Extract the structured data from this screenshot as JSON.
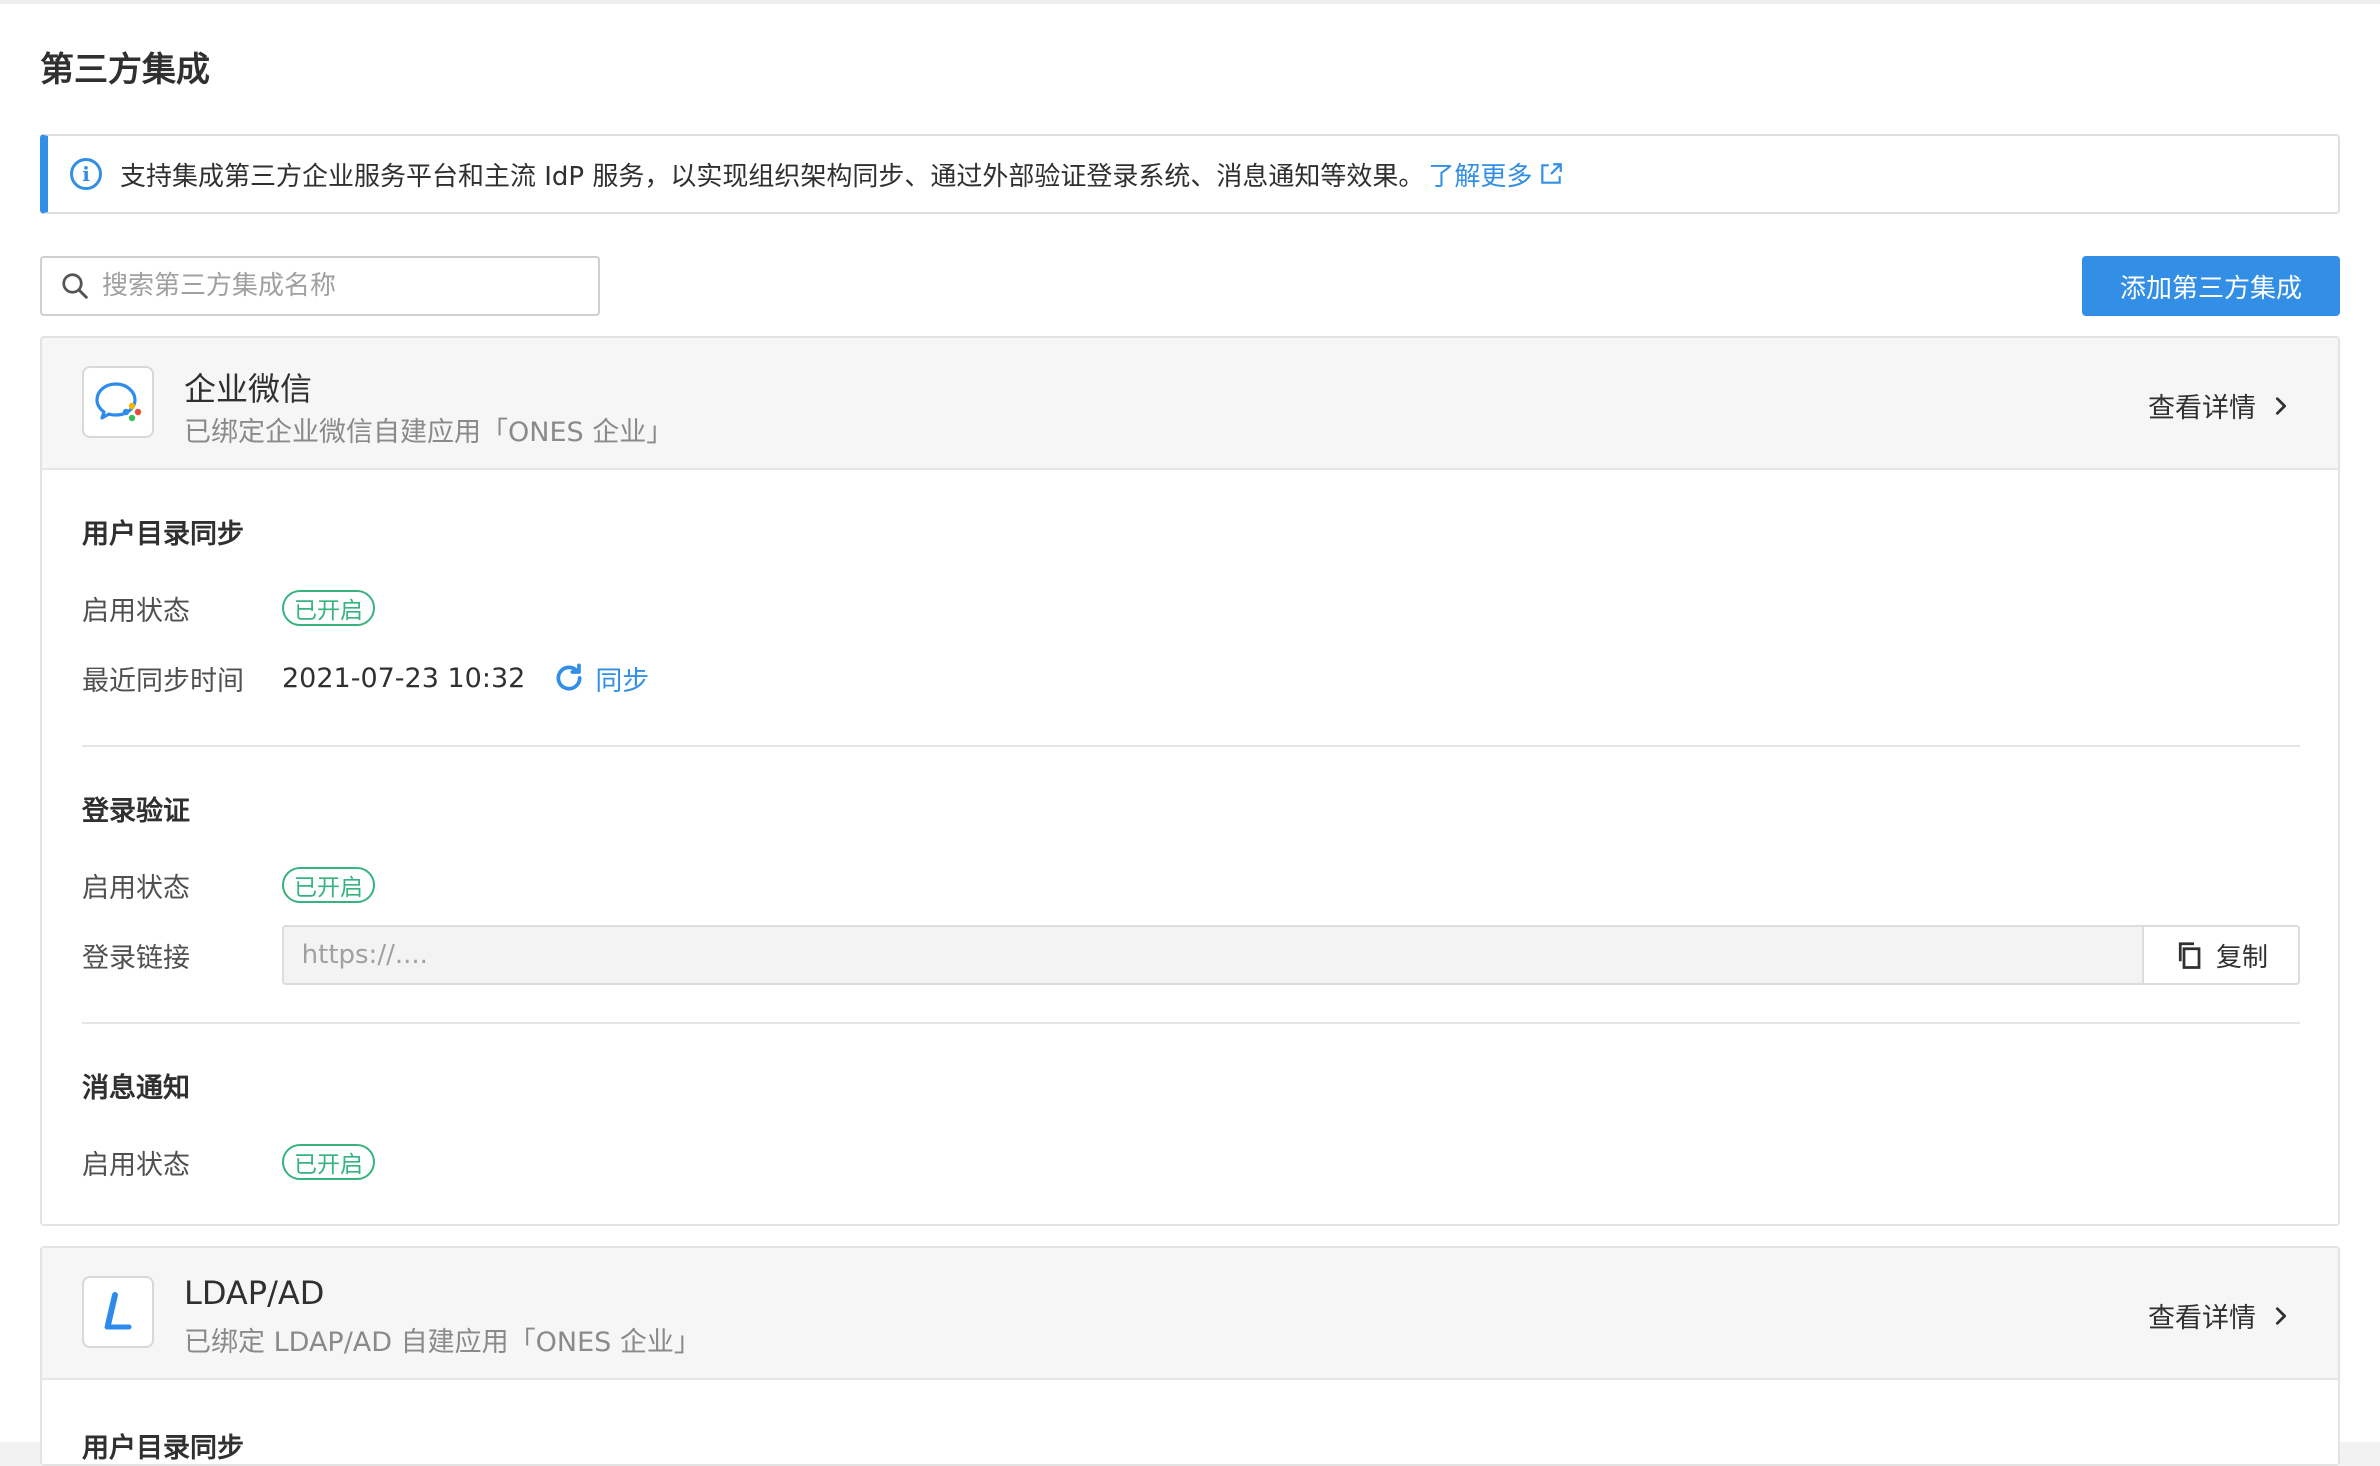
{
  "page": {
    "title": "第三方集成"
  },
  "banner": {
    "text": "支持集成第三方企业服务平台和主流 IdP 服务，以实现组织架构同步、通过外部验证登录系统、消息通知等效果。",
    "link_label": "了解更多"
  },
  "search": {
    "value": "",
    "placeholder": "搜索第三方集成名称"
  },
  "toolbar": {
    "add_label": "添加第三方集成"
  },
  "integrations": [
    {
      "name": "企业微信",
      "description": "已绑定企业微信自建应用「ONES 企业」",
      "details_label": "查看详情",
      "logo_icon": "wecom-logo-icon",
      "user_sync": {
        "title": "用户目录同步",
        "status_label": "启用状态",
        "status": "已开启",
        "last_sync_label": "最近同步时间",
        "last_sync_time": "2021-07-23 10:32",
        "sync_label": "同步"
      },
      "login": {
        "title": "登录验证",
        "status_label": "启用状态",
        "status": "已开启",
        "link_label": "登录链接",
        "link_value": "",
        "link_placeholder": "https://....",
        "copy_label": "复制"
      },
      "notification": {
        "title": "消息通知",
        "status_label": "启用状态",
        "status": "已开启"
      }
    },
    {
      "name": "LDAP/AD",
      "description": "已绑定 LDAP/AD 自建应用「ONES 企业」",
      "details_label": "查看详情",
      "logo_icon": "ldap-logo-icon",
      "user_sync": {
        "title": "用户目录同步"
      }
    }
  ],
  "colors": {
    "accent": "#338fe5",
    "success": "#36b37e",
    "header_bg": "#f6f6f6"
  }
}
